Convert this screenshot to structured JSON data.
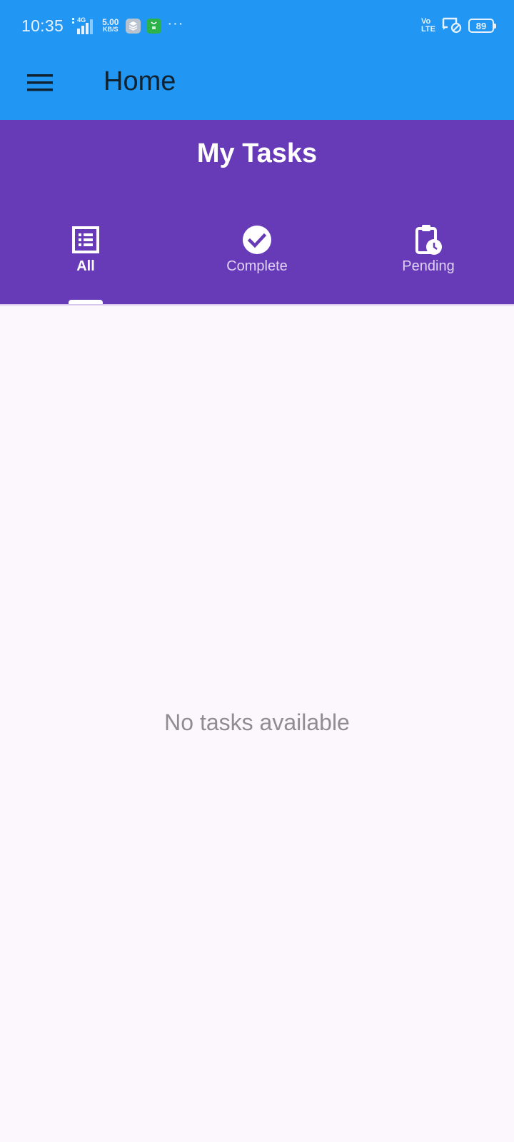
{
  "status_bar": {
    "time": "10:35",
    "network": "4G",
    "speed_value": "5.00",
    "speed_unit": "KB/S",
    "more": "···",
    "volte_top": "Vo",
    "volte_bottom": "LTE",
    "battery": "89"
  },
  "app_bar": {
    "title": "Home"
  },
  "tasks": {
    "title": "My Tasks",
    "tabs": [
      {
        "label": "All",
        "icon": "list-icon",
        "active": true
      },
      {
        "label": "Complete",
        "icon": "check-circle-icon",
        "active": false
      },
      {
        "label": "Pending",
        "icon": "clipboard-clock-icon",
        "active": false
      }
    ],
    "empty_message": "No tasks available"
  },
  "colors": {
    "app_bar": "#2196f3",
    "tasks_header": "#673ab7",
    "background": "#fcf6fd",
    "title_text": "#10212f"
  }
}
